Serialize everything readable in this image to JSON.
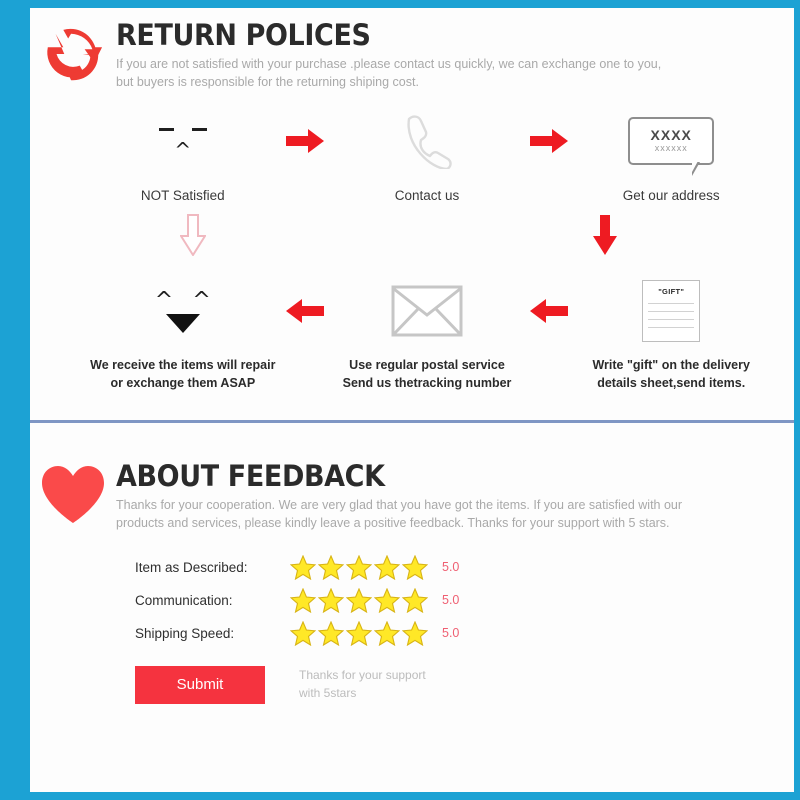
{
  "theme": {
    "frame_blue": "#1ca2d4",
    "divider_blue": "#7f96c4",
    "accent_red": "#ee3b33",
    "submit_red": "#f5333f",
    "star_yellow": "#ffe827",
    "score_pink": "#ef5f72"
  },
  "return_section": {
    "icon": "return-arrows-icon",
    "title": "RETURN POLICES",
    "subtitle_line1": "If you are not satisfied with your purchase .please contact us quickly, we can exchange one to you,",
    "subtitle_line2": "but buyers is responsible for the returning shiping cost.",
    "steps_row1": [
      {
        "icon": "sad-face-icon",
        "label": "NOT Satisfied"
      },
      {
        "icon": "phone-icon",
        "label": "Contact us"
      },
      {
        "icon": "speech-bubble-icon",
        "bubble_line1": "XXXX",
        "bubble_line2": "xxxxxx",
        "label": "Get our address"
      }
    ],
    "steps_row2": [
      {
        "icon": "happy-face-icon",
        "label_line1": "We receive the items will repair",
        "label_line2": "or exchange them ASAP"
      },
      {
        "icon": "envelope-icon",
        "label_line1": "Use regular postal service",
        "label_line2": "Send us thetracking number"
      },
      {
        "icon": "gift-document-icon",
        "doc_title": "\"GIFT\"",
        "label_line1": "Write \"gift\" on the delivery",
        "label_line2": "details sheet,send items."
      }
    ],
    "arrows": {
      "right1": "arrow-right-icon",
      "right2": "arrow-right-icon",
      "down_left": "arrow-down-outline-icon",
      "down_right": "arrow-down-solid-icon",
      "left1": "arrow-left-icon",
      "left2": "arrow-left-icon"
    }
  },
  "feedback_section": {
    "icon": "heart-icon",
    "title": "ABOUT FEEDBACK",
    "subtitle_line1": "Thanks for your cooperation. We are very glad that you have got the items. If you are satisfied with our",
    "subtitle_line2": "products and services, please kindly leave a positive feedback. Thanks for your support with 5 stars.",
    "ratings": [
      {
        "label": "Item as Described:",
        "stars": 5,
        "score": "5.0"
      },
      {
        "label": "Communication:",
        "stars": 5,
        "score": "5.0"
      },
      {
        "label": "Shipping Speed:",
        "stars": 5,
        "score": "5.0"
      }
    ],
    "submit_label": "Submit",
    "submit_note_line1": "Thanks for your support",
    "submit_note_line2": "with 5stars"
  }
}
